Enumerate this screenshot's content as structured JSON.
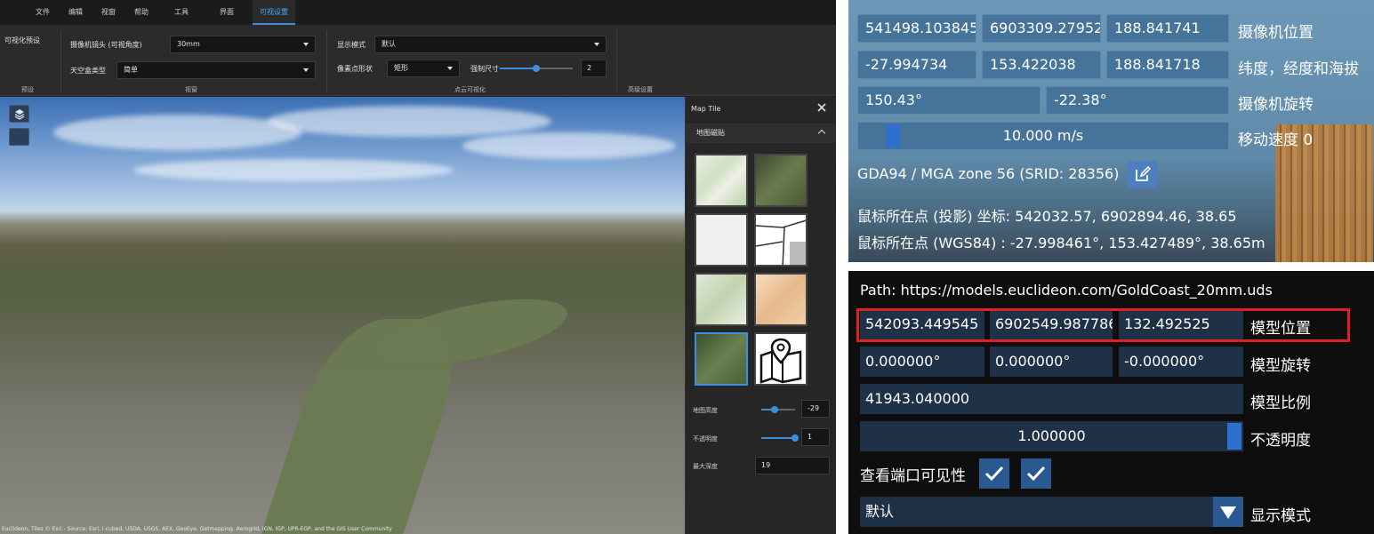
{
  "menu": {
    "items": [
      "文件",
      "编辑",
      "视窗",
      "帮助",
      "工具",
      "界面",
      "可视设置"
    ]
  },
  "ribbon": {
    "preset_label": "可视化预设",
    "preset_group": "预设",
    "camera_lens_label": "摄像机镜头 (可视角度)",
    "camera_lens_value": "30mm",
    "skybox_label": "天空盒类型",
    "skybox_value": "简单",
    "viewport_group": "视窗",
    "display_mode_label": "显示模式",
    "display_mode_value": "默认",
    "point_shape_label": "像素点形状",
    "point_shape_value": "矩形",
    "point_size_label": "强制尺寸",
    "point_size_value": "2",
    "point_size_fraction": 0.5,
    "pointcloud_group": "点云可视化",
    "advanced_group": "高级设置"
  },
  "viewport": {
    "attribution": "Euclideon, Tiles © Esri - Source: Esri, i-cubed, USDA, USGS, AEX, GeoEye, Getmapping, Aerogrid, IGN, IGP, UPR-EGP, and the GIS User Community"
  },
  "map_tile": {
    "title": "Map Tile",
    "section": "地图磁贴",
    "tiles": [
      "street-map",
      "satellite",
      "light-gray",
      "osm-lines",
      "topo",
      "terrain",
      "satellite-selected",
      "custom-map"
    ],
    "height_label": "地图高度",
    "height_value": "-29",
    "height_fraction": 0.4,
    "opacity_label": "不透明度",
    "opacity_value": "1",
    "opacity_fraction": 1.0,
    "max_depth_label": "最大深度",
    "max_depth_value": "19"
  },
  "camera_panel": {
    "position": [
      "541498.103845",
      "6903309.27952",
      "188.841741"
    ],
    "position_label": "摄像机位置",
    "latlon": [
      "-27.994734",
      "153.422038",
      "188.841718"
    ],
    "latlon_label": "纬度，经度和海拔",
    "rotation": [
      "150.43°",
      "-22.38°"
    ],
    "rotation_label": "摄像机旋转",
    "speed_value": "10.000 m/s",
    "speed_fraction": 0.07,
    "speed_label": "移动速度 0",
    "srid": "GDA94 / MGA zone 56 (SRID: 28356)",
    "mouse_projected": "鼠标所在点 (投影) 坐标: 542032.57, 6902894.46, 38.65",
    "mouse_wgs84": "鼠标所在点 (WGS84) : -27.998461°, 153.427489°, 38.65m"
  },
  "model_panel": {
    "path": "Path: https://models.euclideon.com/GoldCoast_20mm.uds",
    "position": [
      "542093.449545",
      "6902549.987786",
      "132.492525"
    ],
    "position_label": "模型位置",
    "rotation": [
      "0.000000°",
      "0.000000°",
      "-0.000000°"
    ],
    "rotation_label": "模型旋转",
    "scale_value": "41943.040000",
    "scale_label": "模型比例",
    "opacity_value": "1.000000",
    "opacity_fraction": 1.0,
    "opacity_label": "不透明度",
    "visibility_label": "查看端口可见性",
    "display_mode_value": "默认",
    "display_mode_label": "显示模式"
  }
}
